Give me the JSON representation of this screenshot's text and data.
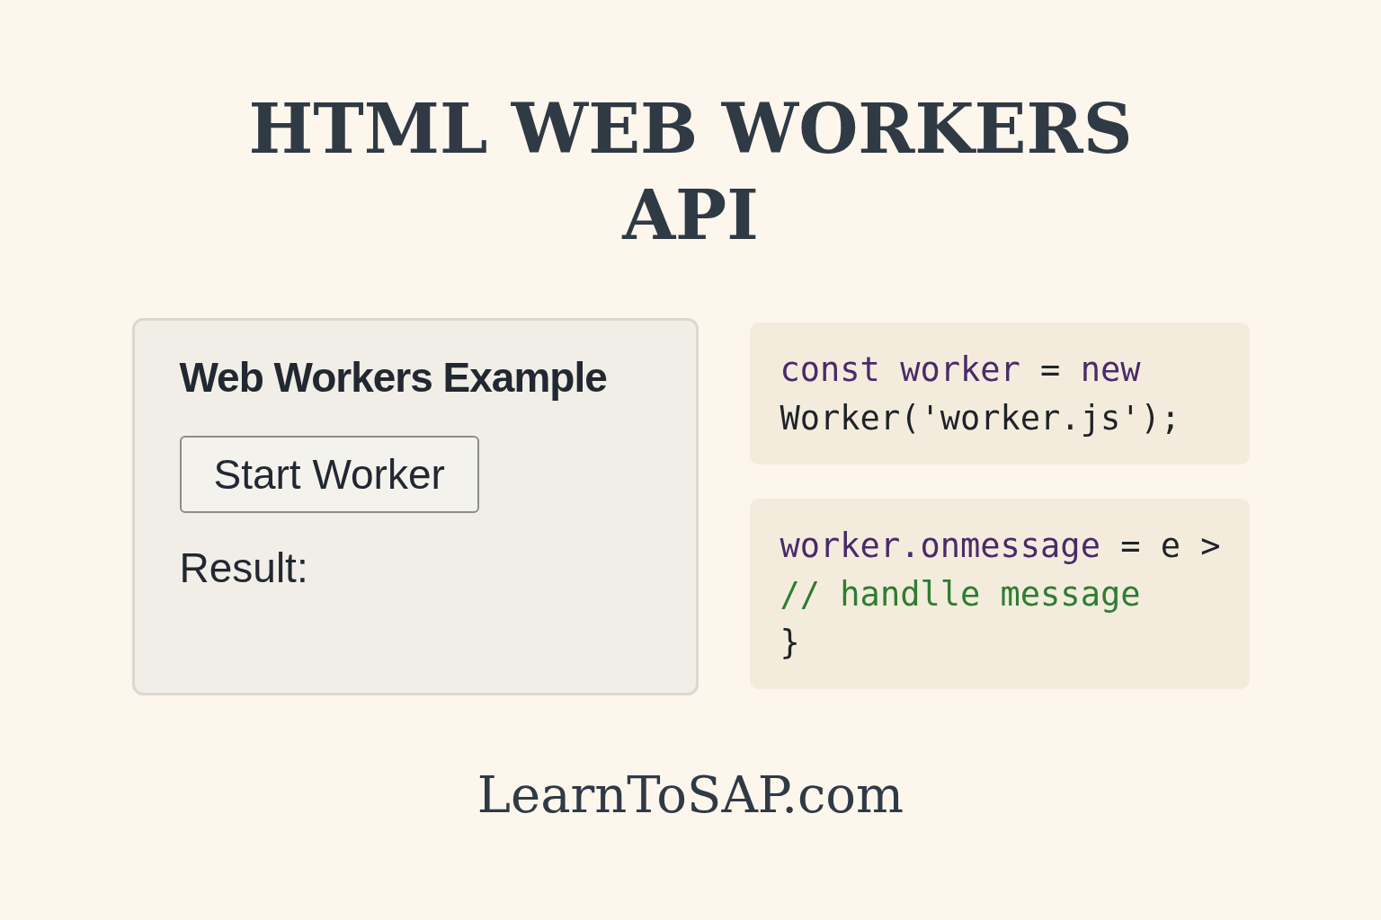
{
  "title": "HTML WEB WORKERS API",
  "demo": {
    "heading": "Web Workers Example",
    "button": "Start Worker",
    "result_label": "Result:"
  },
  "code_blocks": [
    {
      "lines": [
        [
          {
            "kind": "keyword",
            "text": "const worker"
          },
          {
            "kind": "plain",
            "text": " = "
          },
          {
            "kind": "keyword",
            "text": "new"
          }
        ],
        [
          {
            "kind": "plain",
            "text": "Worker('worker.js');"
          }
        ]
      ]
    },
    {
      "lines": [
        [
          {
            "kind": "keyword",
            "text": "worker.onmessage"
          },
          {
            "kind": "plain",
            "text": " = e >"
          }
        ],
        [
          {
            "kind": "comment",
            "text": "// handlle message"
          }
        ],
        [
          {
            "kind": "plain",
            "text": "}"
          }
        ]
      ]
    }
  ],
  "footer": "LearnToSAP.com"
}
